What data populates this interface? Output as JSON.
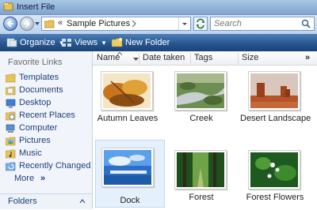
{
  "window": {
    "title": "Insert File"
  },
  "address": {
    "chevron": "«",
    "path": "Sample Pictures"
  },
  "search": {
    "placeholder": "Search"
  },
  "toolbar": {
    "organize": "Organize",
    "views": "Views",
    "new_folder": "New Folder"
  },
  "sidebar": {
    "title": "Favorite Links",
    "items": [
      {
        "label": "Templates",
        "icon": "folder-icon"
      },
      {
        "label": "Documents",
        "icon": "documents-icon"
      },
      {
        "label": "Desktop",
        "icon": "desktop-icon"
      },
      {
        "label": "Recent Places",
        "icon": "recent-places-icon"
      },
      {
        "label": "Computer",
        "icon": "computer-icon"
      },
      {
        "label": "Pictures",
        "icon": "pictures-icon"
      },
      {
        "label": "Music",
        "icon": "music-icon"
      },
      {
        "label": "Recently Changed",
        "icon": "recently-changed-icon"
      },
      {
        "label": "More",
        "icon": "chevron-double-right-icon"
      }
    ],
    "more_chevron": "»",
    "folders_label": "Folders"
  },
  "columns": {
    "name": "Name",
    "date_taken": "Date taken",
    "tags": "Tags",
    "size": "Size",
    "more": "»"
  },
  "files": [
    {
      "name": "Autumn Leaves",
      "selected": false
    },
    {
      "name": "Creek",
      "selected": false
    },
    {
      "name": "Desert Landscape",
      "selected": false
    },
    {
      "name": "Dock",
      "selected": true
    },
    {
      "name": "Forest",
      "selected": false
    },
    {
      "name": "Forest Flowers",
      "selected": false
    }
  ],
  "colors": {
    "command_bar": "#26538c",
    "selection": "#e4f0fb",
    "link_text": "#1f3f7a"
  }
}
